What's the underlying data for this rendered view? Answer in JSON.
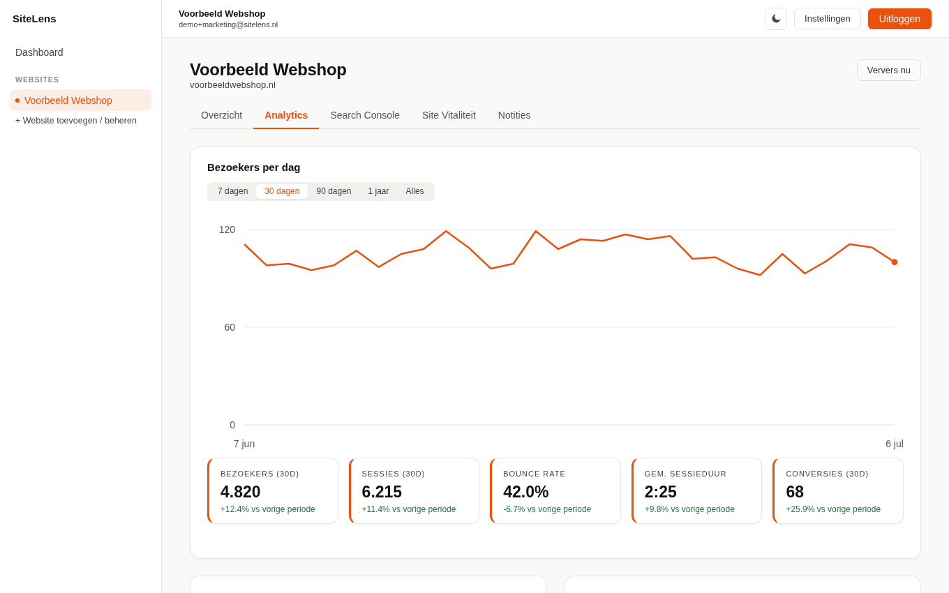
{
  "sidebar": {
    "brand": "SiteLens",
    "nav": [
      {
        "label": "Dashboard",
        "selected": false
      }
    ],
    "section_label": "WEBSITES",
    "sites": [
      {
        "label": "Voorbeeld Webshop",
        "selected": true
      }
    ],
    "add_link": "+ Website toevoegen / beheren"
  },
  "header": {
    "title": "Voorbeeld Webshop",
    "email": "demo+marketing@sitelens.nl",
    "buttons": [
      {
        "kind": "theme"
      },
      {
        "kind": "secondary",
        "label": "Instellingen"
      },
      {
        "kind": "primary",
        "label": "Uitloggen"
      }
    ]
  },
  "page": {
    "title": "Voorbeeld Webshop",
    "domain": "voorbeeldwebshop.nl",
    "refresh_button": "Ververs nu",
    "tabs": [
      {
        "label": "Overzicht",
        "selected": false
      },
      {
        "label": "Analytics",
        "selected": true
      },
      {
        "label": "Search Console",
        "selected": false
      },
      {
        "label": "Site Vitaliteit",
        "selected": false
      },
      {
        "label": "Notities",
        "selected": false
      }
    ]
  },
  "visitors_card": {
    "title": "Bezoekers per dag",
    "ranges": [
      {
        "label": "7 dagen",
        "selected": false
      },
      {
        "label": "30 dagen",
        "selected": true
      },
      {
        "label": "90 dagen",
        "selected": false
      },
      {
        "label": "1 jaar",
        "selected": false
      },
      {
        "label": "Alles",
        "selected": false
      }
    ],
    "chart_data": {
      "type": "line",
      "categories": [
        "7 jun",
        null,
        null,
        null,
        null,
        null,
        null,
        null,
        null,
        null,
        null,
        null,
        null,
        null,
        null,
        null,
        null,
        null,
        null,
        null,
        null,
        null,
        null,
        null,
        null,
        null,
        null,
        null,
        null,
        "6 jul"
      ],
      "ylim": [
        0,
        120
      ],
      "yticks": [
        0,
        60,
        120
      ],
      "series": [
        {
          "color": "#e8520c",
          "values": [
            111,
            98,
            99,
            95,
            98,
            107,
            97,
            105,
            108,
            119,
            109,
            96,
            99,
            119,
            108,
            114,
            113,
            117,
            114,
            116,
            102,
            103,
            96,
            92,
            105,
            93,
            101,
            111,
            109,
            100
          ]
        }
      ]
    },
    "stats": [
      {
        "label": "BEZOEKERS (30D)",
        "value": "4.820",
        "change": "+12.4% vs vorige periode",
        "positive": true
      },
      {
        "label": "SESSIES (30D)",
        "value": "6.215",
        "change": "+11.4% vs vorige periode",
        "positive": true
      },
      {
        "label": "BOUNCE RATE",
        "value": "42.0%",
        "change": "-6.7% vs vorige periode",
        "positive": true
      },
      {
        "label": "GEM. SESSIEDUUR",
        "value": "2:25",
        "change": "+9.8% vs vorige periode",
        "positive": true
      },
      {
        "label": "CONVERSIES (30D)",
        "value": "68",
        "change": "+25.9% vs vorige periode",
        "positive": true
      }
    ]
  },
  "lower_cards": [
    {
      "kind": "panel"
    },
    {
      "kind": "panel"
    }
  ]
}
